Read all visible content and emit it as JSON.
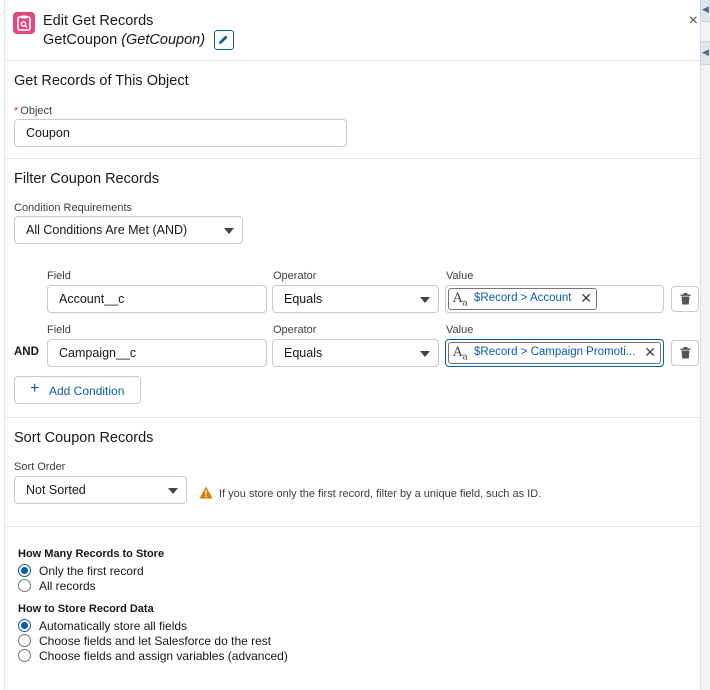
{
  "header": {
    "title": "Edit Get Records",
    "element_label": "GetCoupon",
    "api_name": "(GetCoupon)",
    "close_symbol": "×"
  },
  "object_section": {
    "title": "Get Records of This Object",
    "object_label": "Object",
    "required_marker": "*",
    "object_value": "Coupon"
  },
  "filter_section": {
    "title": "Filter Coupon Records",
    "condition_req_label": "Condition Requirements",
    "condition_req_value": "All Conditions Are Met (AND)",
    "field_label": "Field",
    "operator_label": "Operator",
    "value_label": "Value",
    "conditions": [
      {
        "connector": "",
        "field": "Account__c",
        "operator": "Equals",
        "value": "$Record > Account"
      },
      {
        "connector": "AND",
        "field": "Campaign__c",
        "operator": "Equals",
        "value": "$Record > Campaign Promoti..."
      }
    ],
    "add_condition_label": "Add Condition"
  },
  "sort_section": {
    "title": "Sort Coupon Records",
    "sort_order_label": "Sort Order",
    "sort_order_value": "Not Sorted",
    "warning": "If you store only the first record, filter by a unique field, such as ID."
  },
  "store_section": {
    "how_many_label": "How Many Records to Store",
    "how_many_options": [
      {
        "label": "Only the first record",
        "selected": true
      },
      {
        "label": "All records",
        "selected": false
      }
    ],
    "how_store_label": "How to Store Record Data",
    "how_store_options": [
      {
        "label": "Automatically store all fields",
        "selected": true
      },
      {
        "label": "Choose fields and let Salesforce do the rest",
        "selected": false
      },
      {
        "label": "Choose fields and assign variables (advanced)",
        "selected": false
      }
    ]
  },
  "colors": {
    "accent": "#0b5cab",
    "app_icon": "#e3477c",
    "warning": "#dd7a01"
  },
  "icons": {
    "app": "get-records-icon",
    "edit": "pencil-icon",
    "close": "close-icon",
    "text_resource": "text-resource-icon",
    "remove": "close-icon",
    "delete": "trash-icon",
    "add": "plus-icon",
    "warning": "warning-icon"
  }
}
